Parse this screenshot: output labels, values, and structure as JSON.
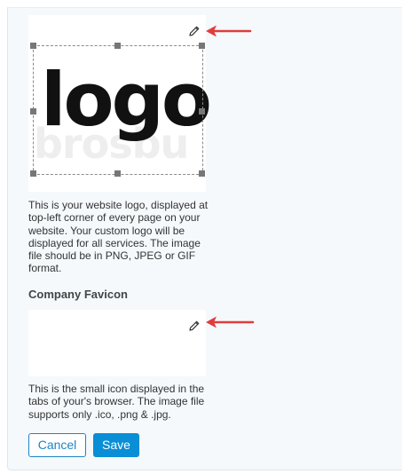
{
  "logo_section": {
    "ghost_text": "brosbu",
    "preview_text": "logo",
    "description": "This is your website logo, displayed at top-left corner of every page on your website. Your custom logo will be displayed for all services. The image file should be in PNG, JPEG or GIF format."
  },
  "favicon_section": {
    "title": "Company Favicon",
    "description": "This is the small icon displayed in the tabs of your's browser. The image file supports only .ico, .png & .jpg."
  },
  "actions": {
    "cancel_label": "Cancel",
    "save_label": "Save"
  },
  "colors": {
    "primary": "#0a8ed6",
    "annotation_arrow": "#e03c3c"
  },
  "icons": [
    "pencil-edit-icon",
    "red-arrow"
  ]
}
